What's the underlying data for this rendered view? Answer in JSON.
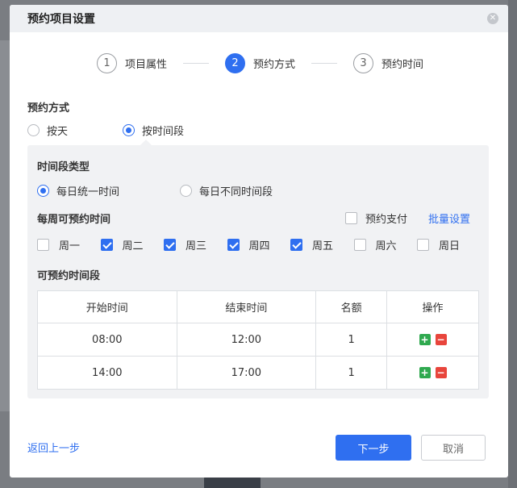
{
  "dialog": {
    "title": "预约项目设置",
    "close_icon": "close-icon"
  },
  "steps": [
    {
      "num": "1",
      "label": "项目属性",
      "active": false
    },
    {
      "num": "2",
      "label": "预约方式",
      "active": true
    },
    {
      "num": "3",
      "label": "预约时间",
      "active": false
    }
  ],
  "booking_mode": {
    "title": "预约方式",
    "options": [
      {
        "label": "按天",
        "checked": false
      },
      {
        "label": "按时间段",
        "checked": true
      }
    ]
  },
  "slot_type": {
    "title": "时间段类型",
    "options": [
      {
        "label": "每日统一时间",
        "checked": true
      },
      {
        "label": "每日不同时间段",
        "checked": false
      }
    ]
  },
  "weekly": {
    "title": "每周可预约时间",
    "pay_label": "预约支付",
    "pay_checked": false,
    "batch_link": "批量设置",
    "days": [
      {
        "label": "周一",
        "checked": false
      },
      {
        "label": "周二",
        "checked": true
      },
      {
        "label": "周三",
        "checked": true
      },
      {
        "label": "周四",
        "checked": true
      },
      {
        "label": "周五",
        "checked": true
      },
      {
        "label": "周六",
        "checked": false
      },
      {
        "label": "周日",
        "checked": false
      }
    ]
  },
  "slots": {
    "title": "可预约时间段",
    "columns": [
      "开始时间",
      "结束时间",
      "名额",
      "操作"
    ],
    "rows": [
      {
        "start": "08:00",
        "end": "12:00",
        "quota": "1"
      },
      {
        "start": "14:00",
        "end": "17:00",
        "quota": "1"
      }
    ],
    "add_symbol": "+",
    "del_symbol": "−"
  },
  "footer": {
    "back_label": "返回上一步",
    "next_label": "下一步",
    "cancel_label": "取消"
  },
  "colors": {
    "primary": "#2f6ff0",
    "add": "#2fa94f",
    "delete": "#e8453c"
  }
}
